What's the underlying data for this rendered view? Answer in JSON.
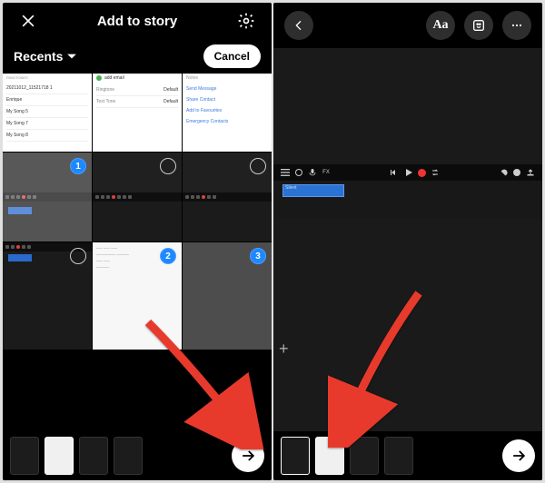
{
  "left": {
    "header": {
      "title": "Add to story"
    },
    "subheader": {
      "recents_label": "Recents",
      "cancel_label": "Cancel"
    },
    "row1": {
      "listA": {
        "heading": "RINGTONES",
        "items": [
          "20211012_11521718 1",
          "Enrique",
          "My Song 5",
          "My Song 7",
          "My Song 8"
        ]
      },
      "listB": {
        "add_label": "add email",
        "rows": [
          {
            "k": "Ringtone",
            "v": "Default"
          },
          {
            "k": "Text Tone",
            "v": "Default"
          }
        ]
      },
      "listC": {
        "heading": "Notes",
        "links": [
          "Send Message",
          "Share Contact",
          "Add to Favourites",
          "Emergency Contacts"
        ]
      }
    },
    "badges": {
      "b1": "1",
      "b2": "2",
      "b3": "3"
    },
    "tray": {
      "thumb_count": 4
    }
  },
  "right": {
    "header": {
      "text_tool": "Aa"
    },
    "daw": {
      "fx_label": "FX",
      "clip_label": "Silent"
    }
  },
  "colors": {
    "blue": "#1e88ff",
    "red_arrow": "#e83a2c",
    "rec": "#e83a2c"
  }
}
